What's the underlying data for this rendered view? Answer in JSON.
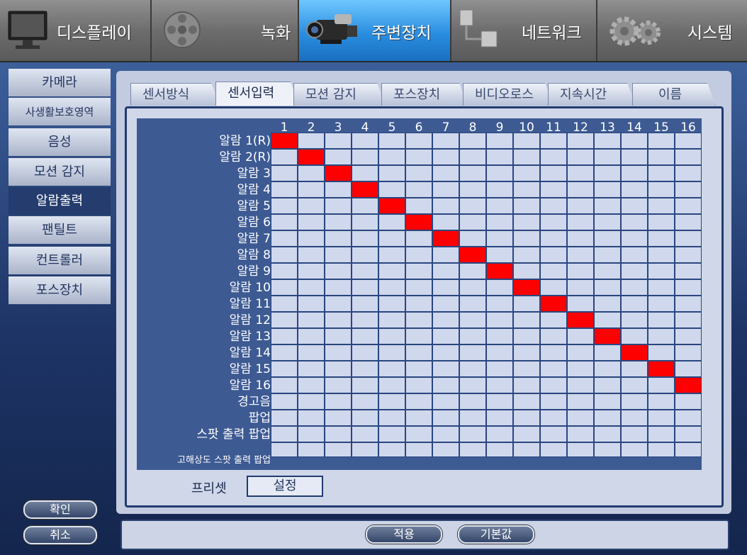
{
  "top_nav": [
    {
      "label": "디스플레이",
      "icon": "monitor-icon",
      "active": false
    },
    {
      "label": "녹화",
      "icon": "film-reel-icon",
      "active": false
    },
    {
      "label": "주변장치",
      "icon": "camcorder-icon",
      "active": true
    },
    {
      "label": "네트워크",
      "icon": "network-icon",
      "active": false
    },
    {
      "label": "시스템",
      "icon": "gear-icon",
      "active": false
    }
  ],
  "sidebar": [
    {
      "label": "카메라",
      "active": false
    },
    {
      "label": "사생활보호영역",
      "active": false
    },
    {
      "label": "음성",
      "active": false
    },
    {
      "label": "모션 감지",
      "active": false
    },
    {
      "label": "알람출력",
      "active": true
    },
    {
      "label": "팬틸트",
      "active": false
    },
    {
      "label": "컨트롤러",
      "active": false
    },
    {
      "label": "포스장치",
      "active": false
    }
  ],
  "sub_tabs": [
    {
      "label": "센서방식",
      "active": false
    },
    {
      "label": "센서입력",
      "active": true
    },
    {
      "label": "모션 감지",
      "active": false
    },
    {
      "label": "포스장치",
      "active": false
    },
    {
      "label": "비디오로스",
      "active": false
    },
    {
      "label": "지속시간",
      "active": false
    },
    {
      "label": "이름",
      "active": false
    }
  ],
  "grid": {
    "columns": [
      "1",
      "2",
      "3",
      "4",
      "5",
      "6",
      "7",
      "8",
      "9",
      "10",
      "11",
      "12",
      "13",
      "14",
      "15",
      "16"
    ],
    "rows": [
      {
        "label": "알람 1(R)",
        "checked": [
          1
        ]
      },
      {
        "label": "알람 2(R)",
        "checked": [
          2
        ]
      },
      {
        "label": "알람 3",
        "checked": [
          3
        ]
      },
      {
        "label": "알람 4",
        "checked": [
          4
        ]
      },
      {
        "label": "알람 5",
        "checked": [
          5
        ]
      },
      {
        "label": "알람 6",
        "checked": [
          6
        ]
      },
      {
        "label": "알람 7",
        "checked": [
          7
        ]
      },
      {
        "label": "알람 8",
        "checked": [
          8
        ]
      },
      {
        "label": "알람 9",
        "checked": [
          9
        ]
      },
      {
        "label": "알람 10",
        "checked": [
          10
        ]
      },
      {
        "label": "알람 11",
        "checked": [
          11
        ]
      },
      {
        "label": "알람 12",
        "checked": [
          12
        ]
      },
      {
        "label": "알람 13",
        "checked": [
          13
        ]
      },
      {
        "label": "알람 14",
        "checked": [
          14
        ]
      },
      {
        "label": "알람 15",
        "checked": [
          15
        ]
      },
      {
        "label": "알람 16",
        "checked": [
          16
        ]
      },
      {
        "label": "경고음",
        "checked": []
      },
      {
        "label": "팝업",
        "checked": []
      },
      {
        "label": "스팟 출력 팝업",
        "checked": []
      },
      {
        "label": "고해상도 스팟 출력 팝업",
        "checked": []
      }
    ]
  },
  "preset": {
    "label": "프리셋",
    "button": "설정"
  },
  "buttons": {
    "confirm": "확인",
    "cancel": "취소",
    "apply": "적용",
    "default": "기본값"
  },
  "colors": {
    "checked": "#ff0000",
    "unchecked": "#cfd8ec",
    "grid_bg": "#3d5a93",
    "active_tab": "#2a8ee0"
  }
}
